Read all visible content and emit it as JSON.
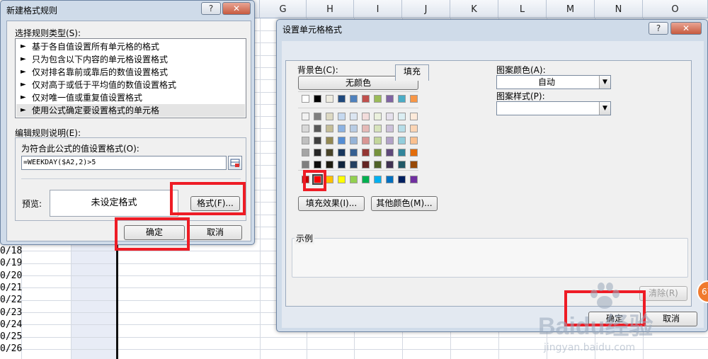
{
  "sheet": {
    "columns": [
      "G",
      "H",
      "I",
      "J",
      "K",
      "L",
      "M",
      "N",
      "O"
    ],
    "rows": [
      "0/18",
      "0/19",
      "0/20",
      "0/21",
      "0/22",
      "0/23",
      "0/24",
      "0/25",
      "0/26"
    ],
    "row_fragments": [
      "1",
      "1",
      "1",
      "1",
      "1",
      "1",
      "1",
      "1",
      "1",
      "1",
      "1",
      "1",
      "1",
      "1",
      "1",
      "1"
    ]
  },
  "rule_dialog": {
    "title": "新建格式规则",
    "help": "?",
    "close": "✕",
    "rule_type_label": "选择规则类型(S):",
    "rule_types": [
      "基于各自值设置所有单元格的格式",
      "只为包含以下内容的单元格设置格式",
      "仅对排名靠前或靠后的数值设置格式",
      "仅对高于或低于平均值的数值设置格式",
      "仅对唯一值或重复值设置格式",
      "使用公式确定要设置格式的单元格"
    ],
    "bullet": "►",
    "edit_label": "编辑规则说明(E):",
    "formula_label": "为符合此公式的值设置格式(O):",
    "formula_value": "=WEEKDAY($A2,2)>5",
    "preview_label": "预览:",
    "preview_text": "未设定格式",
    "format_button": "格式(F)...",
    "ok": "确定",
    "cancel": "取消"
  },
  "cells_dialog": {
    "title": "设置单元格格式",
    "help": "?",
    "close": "✕",
    "tabs": [
      "数字",
      "字体",
      "边框",
      "填充"
    ],
    "active_tab": "填充",
    "bg_label": "背景色(C):",
    "no_color": "无颜色",
    "pattern_color_label": "图案颜色(A):",
    "pattern_color_value": "自动",
    "pattern_style_label": "图案样式(P):",
    "fill_effects": "填充效果(I)...",
    "more_colors": "其他颜色(M)...",
    "sample_label": "示例",
    "clear": "清除(R)",
    "ok": "确定",
    "cancel": "取消",
    "theme_top": [
      "#ffffff",
      "#000000",
      "#eeece1",
      "#1f497d",
      "#4f81bd",
      "#c0504d",
      "#9bbb59",
      "#8064a2",
      "#4bacc6",
      "#f79646"
    ],
    "shades": [
      [
        "#f2f2f2",
        "#7f7f7f",
        "#ddd9c3",
        "#c6d9f0",
        "#dbe5f1",
        "#f2dcdb",
        "#ebf1dd",
        "#e5e0ec",
        "#dbeef3",
        "#fdeada"
      ],
      [
        "#d8d8d8",
        "#595959",
        "#c4bd97",
        "#8db3e2",
        "#b8cce4",
        "#e5b9b7",
        "#d7e3bc",
        "#ccc1d9",
        "#b7dde8",
        "#fbd5b5"
      ],
      [
        "#bfbfbf",
        "#3f3f3f",
        "#938953",
        "#548dd4",
        "#95b3d7",
        "#d99694",
        "#c3d69b",
        "#b2a2c7",
        "#92cddc",
        "#fac08f"
      ],
      [
        "#a5a5a5",
        "#262626",
        "#494429",
        "#17365d",
        "#366092",
        "#953734",
        "#76923c",
        "#5f497a",
        "#31859b",
        "#e36c09"
      ],
      [
        "#7f7f7f",
        "#0c0c0c",
        "#1d1b10",
        "#0f243e",
        "#244061",
        "#632423",
        "#4f6128",
        "#3f3151",
        "#205867",
        "#974806"
      ]
    ],
    "standard": [
      "#c00000",
      "#ff0000",
      "#ffc000",
      "#ffff00",
      "#92d050",
      "#00b050",
      "#00b0f0",
      "#0070c0",
      "#002060",
      "#7030a0"
    ],
    "selected_color": "#ff0000"
  },
  "watermark": {
    "brand": "Baidu经验",
    "url": "jingyan.baidu.com",
    "badge": "67"
  },
  "highlight_color": "#ee1c25"
}
